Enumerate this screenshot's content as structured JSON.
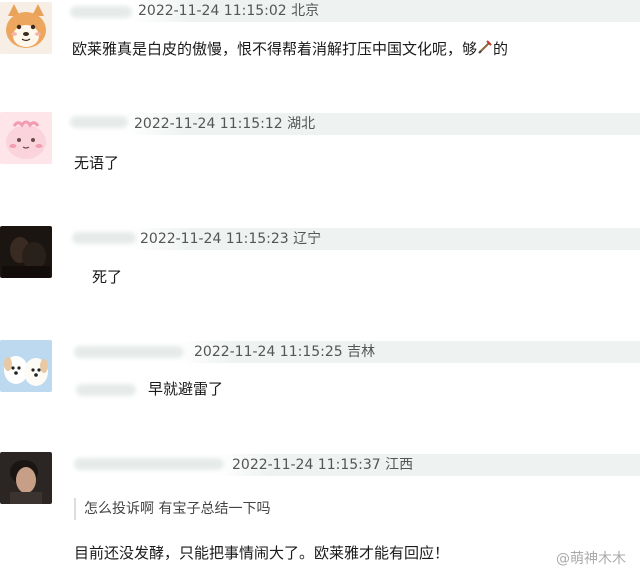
{
  "comments": [
    {
      "avatar": "shiba-dog-avatar",
      "timestamp": "2022-11-24 11:15:02",
      "location": "北京",
      "text": "欧莱雅真是白皮的傲慢，恨不得帮着消解打压中国文化呢，够",
      "text_suffix": "的",
      "inline_icon": "sword-emoji-icon"
    },
    {
      "avatar": "pink-cartoon-avatar",
      "timestamp": "2022-11-24 11:15:12",
      "location": "湖北",
      "text": "无语了"
    },
    {
      "avatar": "dark-photo-avatar",
      "timestamp": "2022-11-24 11:15:23",
      "location": "辽宁",
      "text": "死了"
    },
    {
      "avatar": "puppies-avatar",
      "timestamp": "2022-11-24 11:15:25",
      "location": "吉林",
      "text": "早就避雷了"
    },
    {
      "avatar": "person-photo-avatar",
      "timestamp": "2022-11-24 11:15:37",
      "location": "江西",
      "quote": "怎么投诉啊 有宝子总结一下吗",
      "text": "目前还没发酵，只能把事情闹大了。欧莱雅才能有回应！"
    }
  ],
  "watermark": "@萌神木木",
  "colors": {
    "meta_band": "#eef3f1",
    "text": "#1a1a1a",
    "meta_text": "#555555"
  }
}
